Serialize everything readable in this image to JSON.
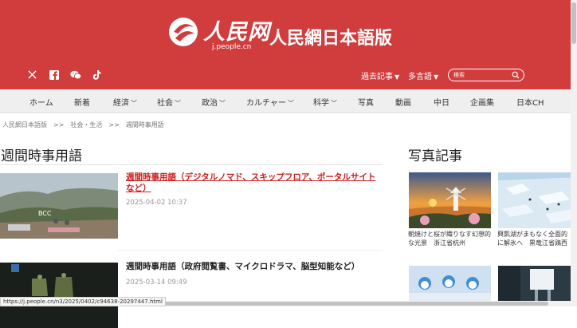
{
  "header": {
    "logo_cn": "人民网",
    "logo_url": "j.people.cn",
    "site_title": "人民網日本語版",
    "past_articles": "過去記事",
    "languages": "多言語",
    "search_placeholder": "検索",
    "bg_color": "#d13c3d"
  },
  "nav": {
    "items": [
      "ホーム",
      "新着",
      "経済",
      "社会",
      "政治",
      "カルチャー",
      "科学",
      "写真",
      "動画",
      "中日",
      "企画集",
      "日本CH"
    ]
  },
  "breadcrumb": {
    "home": "人民網日本語版",
    "separator": ">>",
    "category": "社会・生活",
    "current": "週間時事用語"
  },
  "main": {
    "title": "週間時事用語",
    "articles": [
      {
        "title": "週間時事用語（デジタルノマド、スキップフロア、ポータルサイトなど）",
        "date": "2025-04-02 10:37",
        "thumb_sign": "BCC"
      },
      {
        "title": "週間時事用語（政府閲覧書、マイクロドラマ、脳型知能など）",
        "date": "2025-03-14 09:49"
      }
    ]
  },
  "sidebar": {
    "title": "写真記事",
    "photos": [
      {
        "caption": "朝焼けと桜が織りなす幻想的な光景　浙江省杭州"
      },
      {
        "caption": "興凱湖がまもなく全面的に解氷へ　黒竜江省鶏西"
      },
      {
        "caption": ""
      },
      {
        "caption": ""
      }
    ]
  },
  "status_bar": {
    "url": "https://j.people.cn/n3/2025/0402/c94638-20297447.html"
  }
}
